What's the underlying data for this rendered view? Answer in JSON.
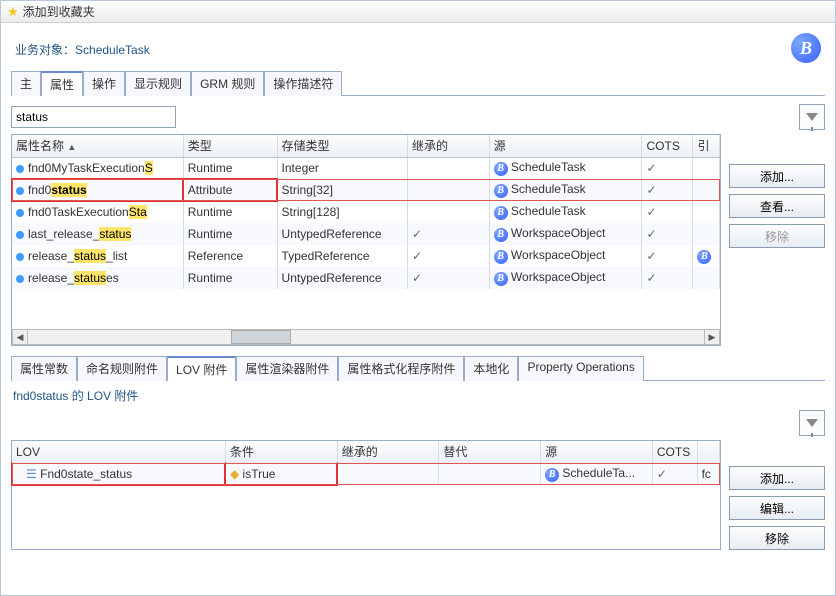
{
  "favorites": {
    "label": "添加到收藏夹"
  },
  "title_prefix": "业务对象：",
  "title_object": "ScheduleTask",
  "tabs_top": [
    {
      "label": "主"
    },
    {
      "label": "属性",
      "active": true
    },
    {
      "label": "操作"
    },
    {
      "label": "显示规则"
    },
    {
      "label": "GRM 规则"
    },
    {
      "label": "操作描述符"
    }
  ],
  "search_value": "status",
  "columns": {
    "name": "属性名称",
    "type": "类型",
    "store": "存储类型",
    "inherited": "继承的",
    "source": "源",
    "cots": "COTS",
    "ref": "引"
  },
  "rows": [
    {
      "name_pre": "fnd0MyTaskExecution",
      "name_hi": "S",
      "type": "Runtime",
      "store": "Integer",
      "inherited": "",
      "source": "ScheduleTask",
      "cots": true,
      "ref": false
    },
    {
      "name_pre": "fnd0",
      "name_hi": "status",
      "bold": true,
      "type": "Attribute",
      "store": "String[32]",
      "inherited": "",
      "source": "ScheduleTask",
      "cots": true,
      "ref": false,
      "red": true
    },
    {
      "name_pre": "fnd0TaskExecution",
      "name_hi": "Sta",
      "type": "Runtime",
      "store": "String[128]",
      "inherited": "",
      "source": "ScheduleTask",
      "cots": true,
      "ref": false
    },
    {
      "name_pre": "last_release_",
      "name_hi": "status",
      "type": "Runtime",
      "store": "UntypedReference",
      "inherited": "✓",
      "source": "WorkspaceObject",
      "cots": true,
      "ref": false
    },
    {
      "name_pre": "release_",
      "name_hi": "status",
      "name_post": "_list",
      "type": "Reference",
      "store": "TypedReference",
      "inherited": "✓",
      "source": "WorkspaceObject",
      "cots": true,
      "ref": true
    },
    {
      "name_pre": "release_",
      "name_hi": "status",
      "name_post": "es",
      "type": "Runtime",
      "store": "UntypedReference",
      "inherited": "✓",
      "source": "WorkspaceObject",
      "cots": true,
      "ref": false
    }
  ],
  "side": {
    "add": "添加...",
    "view": "查看...",
    "remove": "移除"
  },
  "tabs_bottom": [
    {
      "label": "属性常数"
    },
    {
      "label": "命名规则附件"
    },
    {
      "label": "LOV 附件",
      "active": true
    },
    {
      "label": "属性渲染器附件"
    },
    {
      "label": "属性格式化程序附件"
    },
    {
      "label": "本地化"
    },
    {
      "label": "Property Operations"
    }
  ],
  "sub_title": "fnd0status 的 LOV 附件",
  "lov_columns": {
    "lov": "LOV",
    "cond": "条件",
    "inherited": "继承的",
    "alt": "替代",
    "source": "源",
    "cots": "COTS"
  },
  "lov_rows": [
    {
      "lov": "Fnd0state_status",
      "cond": "isTrue",
      "inherited": "",
      "alt": "",
      "source": "ScheduleTa...",
      "cots": true,
      "fc": "fc"
    }
  ],
  "side2": {
    "add": "添加...",
    "edit": "编辑...",
    "remove": "移除"
  }
}
